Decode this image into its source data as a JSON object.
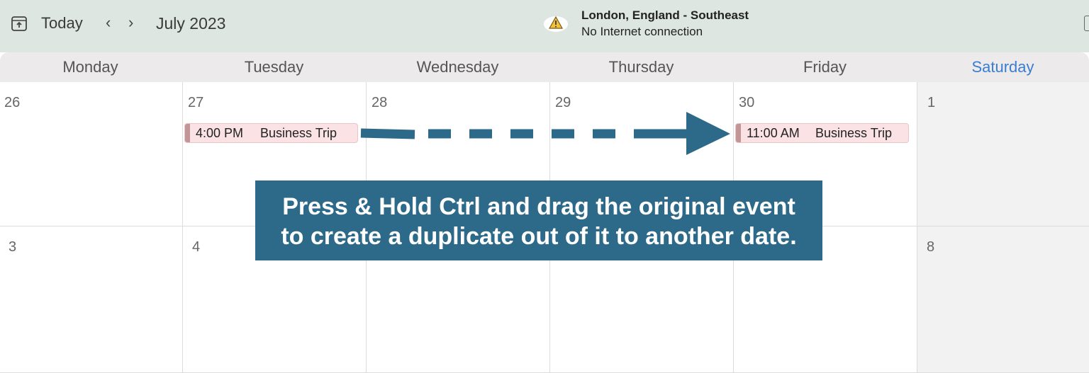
{
  "toolbar": {
    "today_label": "Today",
    "prev_label": "‹",
    "next_label": "›",
    "month_title": "July 2023",
    "location_name": "London, England - Southeast",
    "location_status": "No Internet connection"
  },
  "weekdays": [
    "Monday",
    "Tuesday",
    "Wednesday",
    "Thursday",
    "Friday",
    "Saturday"
  ],
  "weeks": [
    [
      "26",
      "27",
      "28",
      "29",
      "30",
      "1"
    ],
    [
      "3",
      "4",
      "",
      "",
      "",
      "8"
    ]
  ],
  "events": {
    "original": {
      "time": "4:00 PM",
      "title": "Business Trip"
    },
    "duplicate": {
      "time": "11:00 AM",
      "title": "Business Trip"
    }
  },
  "callout": {
    "line1": "Press & Hold Ctrl and drag the original event",
    "line2": "to create a duplicate out of it to another date."
  },
  "colors": {
    "toolbar_bg": "#dde6e0",
    "saturday_accent": "#3a7ecf",
    "event_bg": "#fbe2e4",
    "event_bar": "#c29697",
    "callout_bg": "#2d6a8a"
  }
}
